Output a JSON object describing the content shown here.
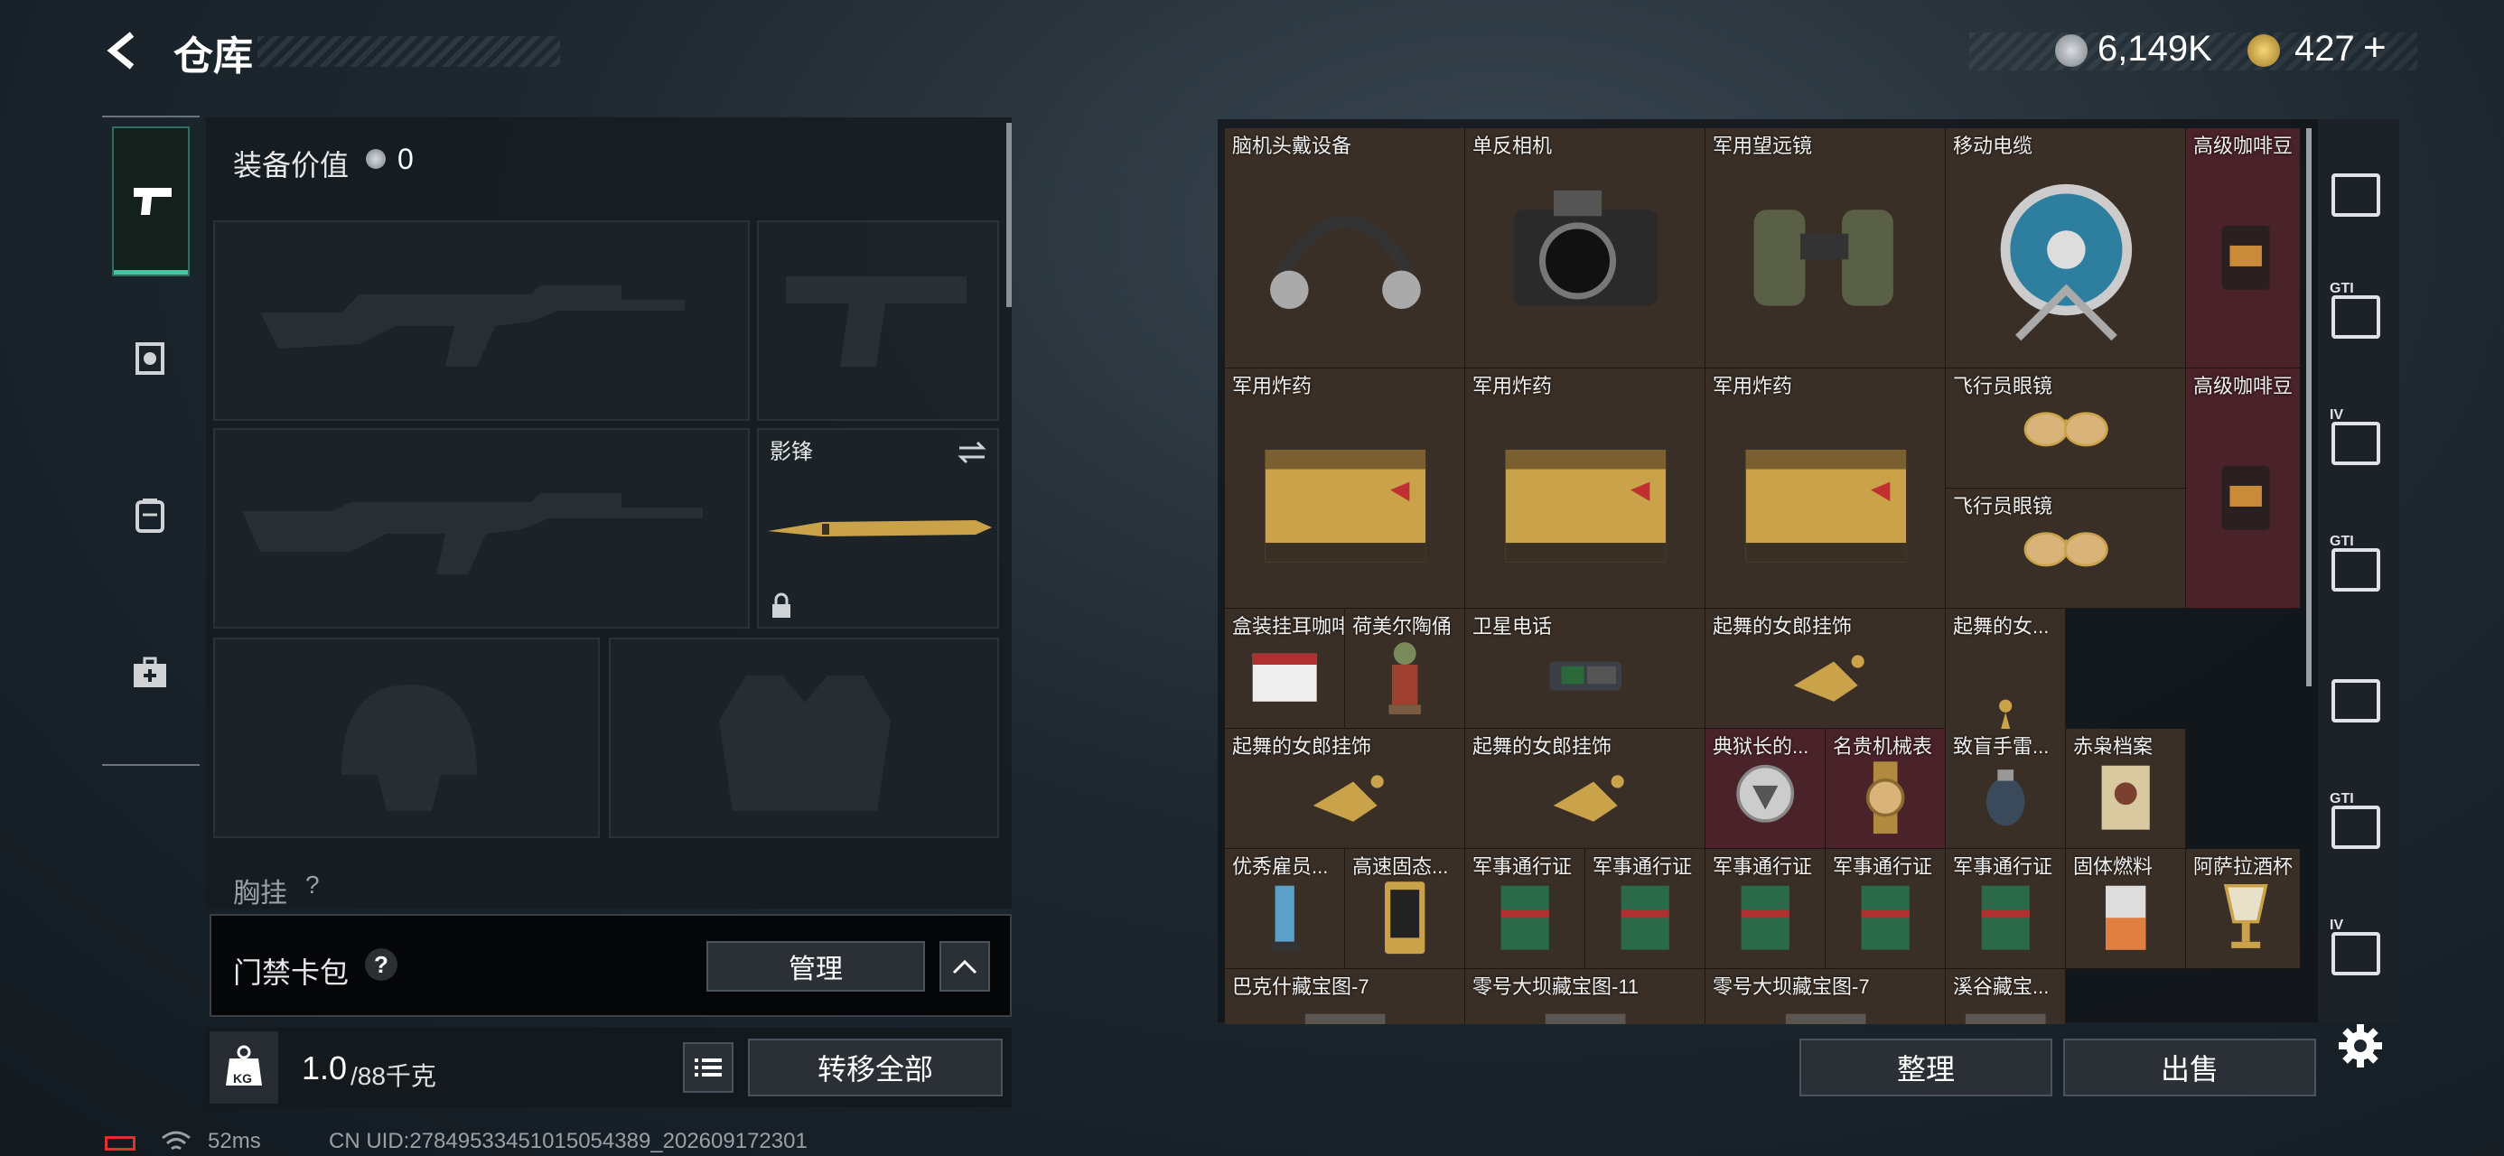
{
  "header": {
    "title": "仓库",
    "currency1": "6,149K",
    "currency2": "427",
    "currency2_plus": "+"
  },
  "loadout": {
    "value_label": "装备价值",
    "value": "0",
    "knife_name": "影锋",
    "chest_label": "胸挂",
    "chest_help": "?",
    "keycard_label": "门禁卡包",
    "keycard_help": "?",
    "manage_label": "管理",
    "weight_value": "1.0",
    "weight_capacity": "/88千克",
    "kg_badge": "KG",
    "transfer_all_label": "转移全部"
  },
  "left_tabs": [
    "weapon-tab",
    "armor-tab",
    "backpack-tab",
    "medical-tab"
  ],
  "stash": {
    "items": [
      {
        "name": "脑机头戴设备",
        "icon": "headset-icon",
        "bg": "#3a2f26"
      },
      {
        "name": "单反相机",
        "icon": "camera-icon",
        "bg": "#3a2f26"
      },
      {
        "name": "军用望远镜",
        "icon": "binoculars-icon",
        "bg": "#3a2f26"
      },
      {
        "name": "移动电缆",
        "icon": "cable-reel-icon",
        "bg": "#3a2f26"
      },
      {
        "name": "高级咖啡豆",
        "icon": "coffee-bag-icon",
        "bg": "#4a2229"
      },
      {
        "name": "军用炸药",
        "icon": "explosive-crate-icon",
        "bg": "#3a2f26"
      },
      {
        "name": "军用炸药",
        "icon": "explosive-crate-icon",
        "bg": "#3a2f26"
      },
      {
        "name": "军用炸药",
        "icon": "explosive-crate-icon",
        "bg": "#3a2f26"
      },
      {
        "name": "飞行员眼镜",
        "icon": "aviator-glasses-icon",
        "bg": "#3a2f26"
      },
      {
        "name": "飞行员眼镜",
        "icon": "aviator-glasses-icon",
        "bg": "#3a2f26"
      },
      {
        "name": "高级咖啡豆",
        "icon": "coffee-bag-icon",
        "bg": "#4a2229"
      },
      {
        "name": "盒装挂耳咖啡",
        "icon": "coffee-box-icon",
        "bg": "#3a2f26"
      },
      {
        "name": "荷美尔陶俑",
        "icon": "figurine-icon",
        "bg": "#3a2f26"
      },
      {
        "name": "卫星电话",
        "icon": "sat-phone-icon",
        "bg": "#3a2f26"
      },
      {
        "name": "起舞的女郎挂饰",
        "icon": "dancer-ornament-icon",
        "bg": "#3a2f26"
      },
      {
        "name": "起舞的女...",
        "icon": "dancer-statue-icon",
        "bg": "#3a2f26"
      },
      {
        "name": "起舞的女郎挂饰",
        "icon": "dancer-ornament-icon",
        "bg": "#3a2f26"
      },
      {
        "name": "起舞的女郎挂饰",
        "icon": "dancer-ornament-icon",
        "bg": "#3a2f26"
      },
      {
        "name": "典狱长的...",
        "icon": "badge-icon",
        "bg": "#4a2229"
      },
      {
        "name": "名贵机械表",
        "icon": "watch-icon",
        "bg": "#4a2229"
      },
      {
        "name": "致盲手雷...",
        "icon": "grenade-icon",
        "bg": "#3a2f26"
      },
      {
        "name": "赤枭档案",
        "icon": "file-icon",
        "bg": "#3a2f26"
      },
      {
        "name": "优秀雇员...",
        "icon": "trophy-icon",
        "bg": "#3a2f26"
      },
      {
        "name": "高速固态...",
        "icon": "ssd-icon",
        "bg": "#3a2f26"
      },
      {
        "name": "军事通行证",
        "icon": "pass-book-icon",
        "bg": "#3a2f26"
      },
      {
        "name": "军事通行证",
        "icon": "pass-book-icon",
        "bg": "#3a2f26"
      },
      {
        "name": "军事通行证",
        "icon": "pass-book-icon",
        "bg": "#3a2f26"
      },
      {
        "name": "军事通行证",
        "icon": "pass-book-icon",
        "bg": "#3a2f26"
      },
      {
        "name": "军事通行证",
        "icon": "pass-book-icon",
        "bg": "#3a2f26"
      },
      {
        "name": "固体燃料",
        "icon": "fuel-icon",
        "bg": "#3a2f26"
      },
      {
        "name": "阿萨拉酒杯",
        "icon": "goblet-icon",
        "bg": "#3a2f26"
      },
      {
        "name": "巴克什藏宝图-7",
        "icon": "map-icon",
        "bg": "#3a2f26"
      },
      {
        "name": "零号大坝藏宝图-11",
        "icon": "map-icon",
        "bg": "#3a2f26"
      },
      {
        "name": "零号大坝藏宝图-7",
        "icon": "map-icon",
        "bg": "#3a2f26"
      },
      {
        "name": "溪谷藏宝...",
        "icon": "map-icon",
        "bg": "#3a2f26"
      }
    ],
    "sort_label": "整理",
    "sell_label": "出售"
  },
  "right_tabs": [
    {
      "icon": "home-icon",
      "label": ""
    },
    {
      "icon": "gt-stash-icon",
      "label": "GTI"
    },
    {
      "icon": "gt-add-icon",
      "label": "IV"
    },
    {
      "icon": "gt-truck-icon",
      "label": "GTI"
    },
    {
      "icon": "gt-vault-selected-icon",
      "label": ""
    },
    {
      "icon": "gt-case-icon",
      "label": "GTI"
    },
    {
      "icon": "gt-box-icon",
      "label": "IV"
    }
  ],
  "status": {
    "ping": "52ms",
    "uid": "CN UID:27849533451015054389_202609172301"
  },
  "colors": {
    "accent": "#45c4a0",
    "gold": "#c9a24a",
    "panel": "#161c21",
    "rare_red": "#4a2229"
  }
}
